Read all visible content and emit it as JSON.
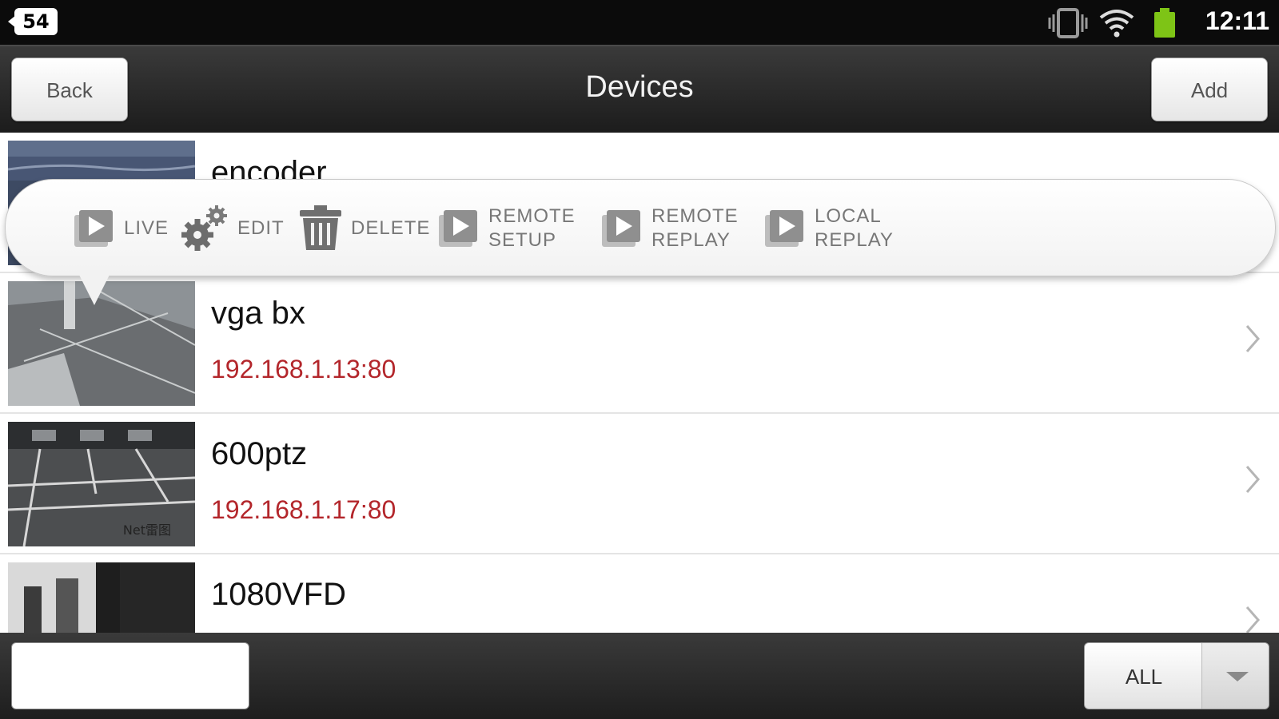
{
  "status_bar": {
    "notification_count": "54",
    "time": "12:11",
    "icons": [
      "vibrate-icon",
      "wifi-icon",
      "battery-icon"
    ]
  },
  "header": {
    "back_label": "Back",
    "title": "Devices",
    "add_label": "Add"
  },
  "popup": {
    "actions": [
      {
        "label": "LIVE",
        "icon": "live-icon"
      },
      {
        "label": "EDIT",
        "icon": "gear-icon"
      },
      {
        "label": "DELETE",
        "icon": "trash-icon"
      },
      {
        "label_line1": "REMOTE",
        "label_line2": "SETUP",
        "icon": "play-icon"
      },
      {
        "label_line1": "REMOTE",
        "label_line2": "REPLAY",
        "icon": "play-icon"
      },
      {
        "label_line1": "LOCAL",
        "label_line2": "REPLAY",
        "icon": "play-icon"
      }
    ]
  },
  "devices": [
    {
      "name": "encoder",
      "address": ""
    },
    {
      "name": "vga bx",
      "address": "192.168.1.13:80"
    },
    {
      "name": "600ptz",
      "address": "192.168.1.17:80"
    },
    {
      "name": "1080VFD",
      "address": ""
    }
  ],
  "thumbnail_watermark": "Net雷图",
  "bottom_bar": {
    "search_value": "",
    "filter_selected": "ALL"
  },
  "colors": {
    "address_red": "#b3262b",
    "header_dark": "#2a2a2a"
  }
}
